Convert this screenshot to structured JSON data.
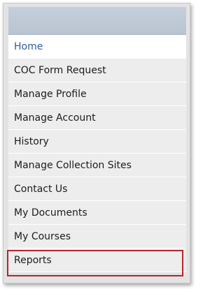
{
  "nav": {
    "items": [
      {
        "label": "Home"
      },
      {
        "label": "COC Form Request"
      },
      {
        "label": "Manage Profile"
      },
      {
        "label": "Manage Account"
      },
      {
        "label": "History"
      },
      {
        "label": "Manage Collection Sites"
      },
      {
        "label": "Contact Us"
      },
      {
        "label": "My Documents"
      },
      {
        "label": "My Courses"
      },
      {
        "label": "Reports"
      }
    ],
    "active_index": 0,
    "highlighted_index": 9
  },
  "colors": {
    "header": "#c5cfdb",
    "active_text": "#2c5d9e",
    "highlight_border": "#b3262c",
    "item_background": "#ededed"
  }
}
